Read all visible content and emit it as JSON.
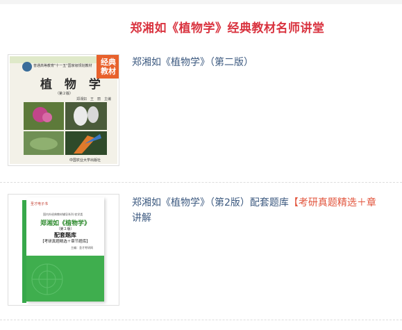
{
  "section": {
    "title": "郑湘如《植物学》经典教材名师讲堂"
  },
  "items": [
    {
      "title": "郑湘如《植物学》（第二版）",
      "badge": [
        "经典",
        "教材"
      ],
      "cover": {
        "series": "普通高等教育\"十一五\"国家级规划教材",
        "book_title": "植 物 学",
        "edition": "（第２版）",
        "authors": "郑湘如　王　丽　主编",
        "publisher": "中国农业大学出版社"
      }
    },
    {
      "title_prefix": "郑湘如《植物学》（第2版）配套题库",
      "title_highlight": "【考研真题精选＋章",
      "title_suffix": "讲解",
      "cover": {
        "logo": "圣才电子书",
        "series": "国内外经典教材辅导系列·农学类",
        "t1": "郑湘如《植物学》",
        "t2": "（第２版）",
        "t3": "配套题库",
        "t4": "【考研真题精选＋章节题库】",
        "t5": "主编：圣才考研网"
      }
    }
  ],
  "colors": {
    "title_red": "#d9333f",
    "link_blue": "#3d5a80",
    "highlight": "#e2543c",
    "badge": "#e8612c",
    "cover2_green": "#3fae4e"
  }
}
